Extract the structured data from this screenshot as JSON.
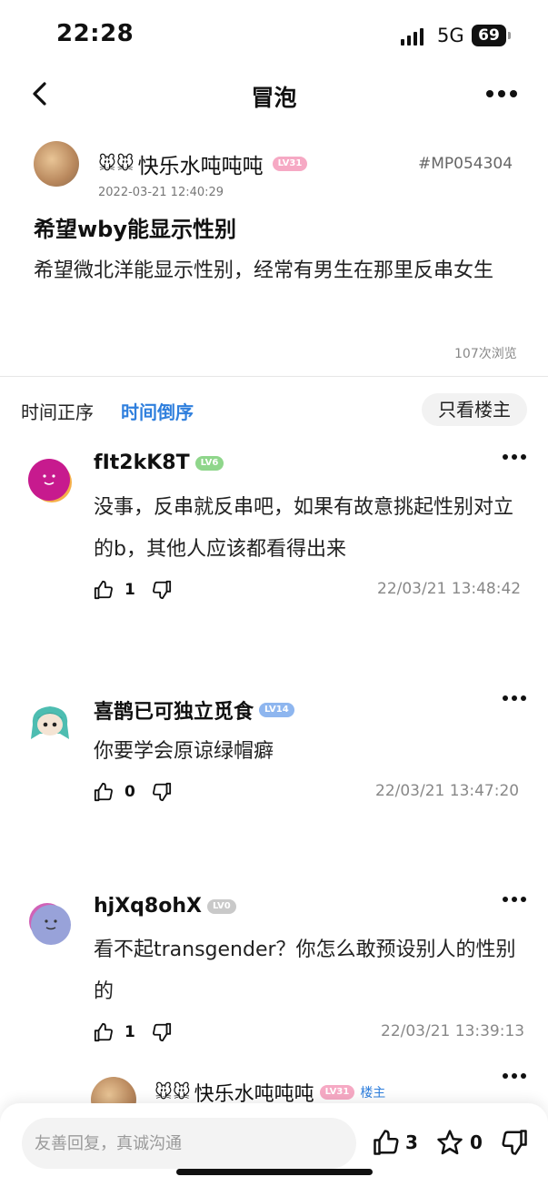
{
  "status_bar": {
    "time": "22:28",
    "network": "5G",
    "battery": "69"
  },
  "nav": {
    "title": "冒泡"
  },
  "post": {
    "user_emoji": "🐭🐭",
    "username": "快乐水吨吨吨",
    "level": "LV31",
    "post_id": "#MP054304",
    "time": "2022-03-21 12:40:29",
    "title": "希望wby能显示性别",
    "body": "希望微北洋能显示性别，经常有男生在那里反串女生",
    "views": "107次浏览"
  },
  "sort": {
    "ascending": "时间正序",
    "descending": "时间倒序",
    "only_op": "只看楼主"
  },
  "comments": [
    {
      "username": "fIt2kK8T",
      "level": "LV6",
      "text": "没事，反串就反串吧，如果有故意挑起性别对立的b，其他人应该都看得出来",
      "likes": "1",
      "time": "22/03/21 13:48:42"
    },
    {
      "username": "喜鹊已可独立觅食",
      "level": "LV14",
      "text": "你要学会原谅绿帽癖",
      "likes": "0",
      "time": "22/03/21 13:47:20"
    },
    {
      "username": "hjXq8ohX",
      "level": "LV0",
      "text": "看不起transgender？你怎么敢预设别人的性别的",
      "likes": "1",
      "time": "22/03/21 13:39:13"
    },
    {
      "user_emoji": "🐭🐭",
      "username": "快乐水吨吨吨",
      "level": "LV31",
      "op_tag": "楼主"
    }
  ],
  "bottom_bar": {
    "placeholder": "友善回复，真诚沟通",
    "likes": "3",
    "favorites": "0"
  },
  "colors": {
    "accent_blue": "#2f7fdd",
    "lv_pink": "#f6a9c4",
    "lv_green": "#8fd68b",
    "lv_blue": "#8eb6ef",
    "lv_gray": "#c9c9c9"
  }
}
